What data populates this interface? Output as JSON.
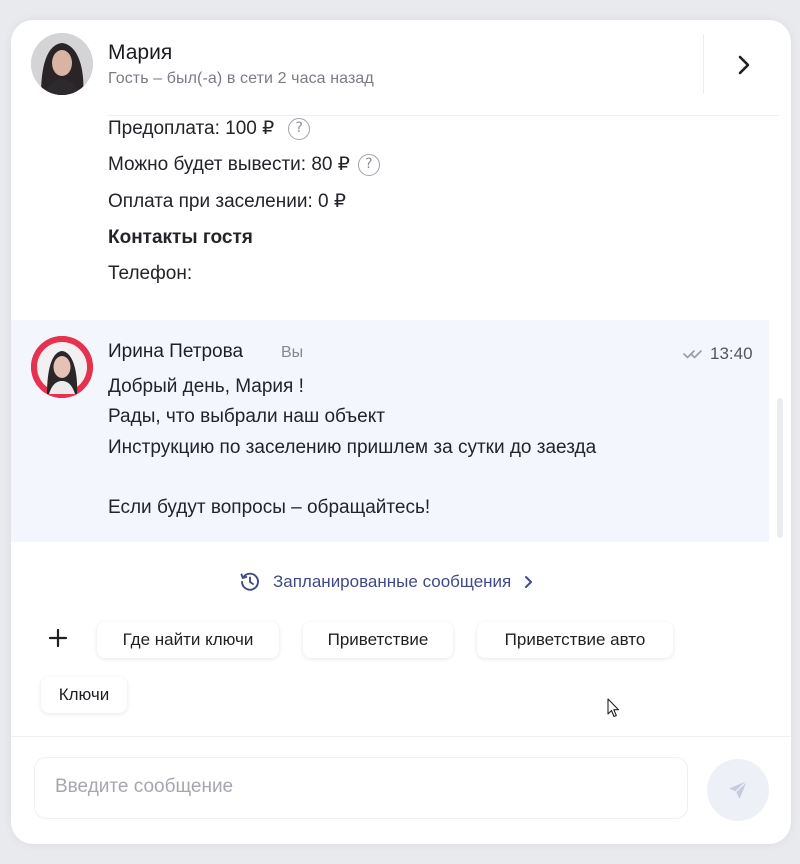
{
  "header": {
    "name": "Мария",
    "status": "Гость – был(-а) в сети 2 часа назад"
  },
  "booking": {
    "prepayment": "Предоплата: 100 ₽",
    "withdrawable": "Можно будет вывести: 80 ₽",
    "on_checkin": "Оплата при заселении: 0 ₽",
    "contacts_title": "Контакты гостя",
    "phone_label": "Телефон:"
  },
  "message": {
    "author": "Ирина Петрова",
    "you_label": "Вы",
    "time": "13:40",
    "lines": [
      "Добрый день, Мария !",
      "Рады, что выбрали наш объект",
      "Инструкцию по заселению пришлем за сутки до заезда",
      "Если будут вопросы – обращайтесь!"
    ]
  },
  "scheduled": {
    "label": "Запланированные сообщения"
  },
  "templates": [
    "Где найти ключи",
    "Приветствие",
    "Приветствие авто",
    "Ключи"
  ],
  "composer": {
    "placeholder": "Введите сообщение"
  },
  "icons": {
    "header_chevron": "chevron-right-icon",
    "help": "question-circle-icon",
    "read_status": "double-check-icon",
    "scheduled": "clock-history-icon",
    "add": "plus-icon",
    "send": "send-plane-icon"
  },
  "colors": {
    "accent": "#3f4a86",
    "message_bg": "#f4f6fd",
    "send_bg": "#eef0f8"
  }
}
